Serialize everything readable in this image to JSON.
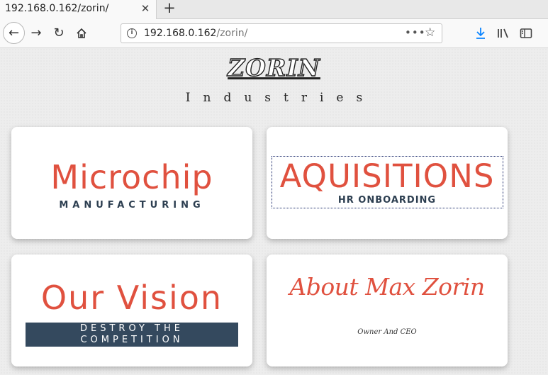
{
  "browser": {
    "tab_title": "192.168.0.162/zorin/",
    "tab_close": "✕",
    "new_tab": "+",
    "url_host": "192.168.0.162",
    "url_path": "/zorin/",
    "url_more": "•••"
  },
  "header": {
    "logo": "ZORIN",
    "tagline": "Industries"
  },
  "cards": [
    {
      "title": "Microchip",
      "subtitle": "MANUFACTURING"
    },
    {
      "title": "AQUISITIONS",
      "subtitle": "HR ONBOARDING"
    },
    {
      "title": "Our Vision",
      "subtitle": "DESTROY THE COMPETITION"
    },
    {
      "title": "About Max Zorin",
      "subtitle": "Owner And CEO"
    }
  ],
  "colors": {
    "accent": "#e0513f",
    "dark": "#2c3e50",
    "banner": "#34495e"
  }
}
